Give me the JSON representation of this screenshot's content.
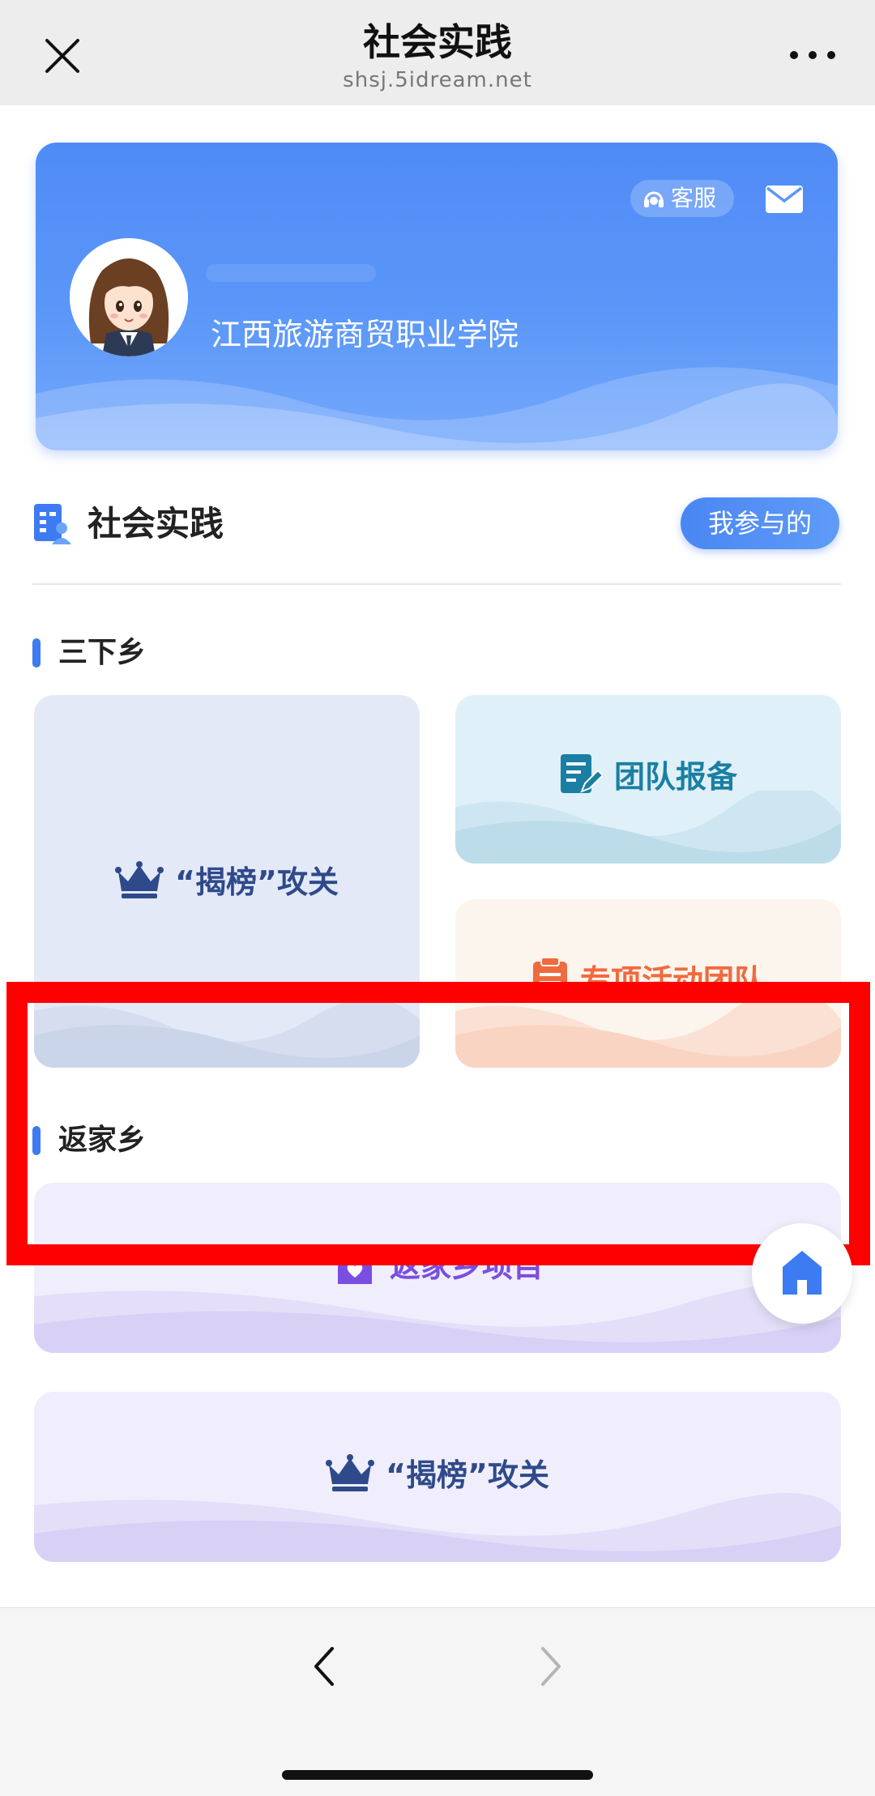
{
  "header": {
    "title": "社会实践",
    "url": "shsj.5idream.net"
  },
  "profile": {
    "service_label": "客服",
    "school": "江西旅游商贸职业学院"
  },
  "section": {
    "title": "社会实践",
    "my_button": "我参与的"
  },
  "groups": [
    {
      "title": "三下乡",
      "tiles": [
        {
          "label": "“揭榜”攻关",
          "icon": "crown-icon",
          "color": "#2f4a8a"
        },
        {
          "label": "团队报备",
          "icon": "edit-note-icon",
          "color": "#1a7fa2"
        },
        {
          "label": "专项活动团队",
          "icon": "clipboard-icon",
          "color": "#f06a3f"
        }
      ]
    },
    {
      "title": "返家乡",
      "tiles": [
        {
          "label": "返家乡项目",
          "icon": "home-heart-icon",
          "color": "#7a4ee0"
        },
        {
          "label": "“揭榜”攻关",
          "icon": "crown-icon",
          "color": "#2f4a8a"
        }
      ]
    }
  ],
  "colors": {
    "accent": "#3d7bf2",
    "highlight": "#ff0000"
  }
}
